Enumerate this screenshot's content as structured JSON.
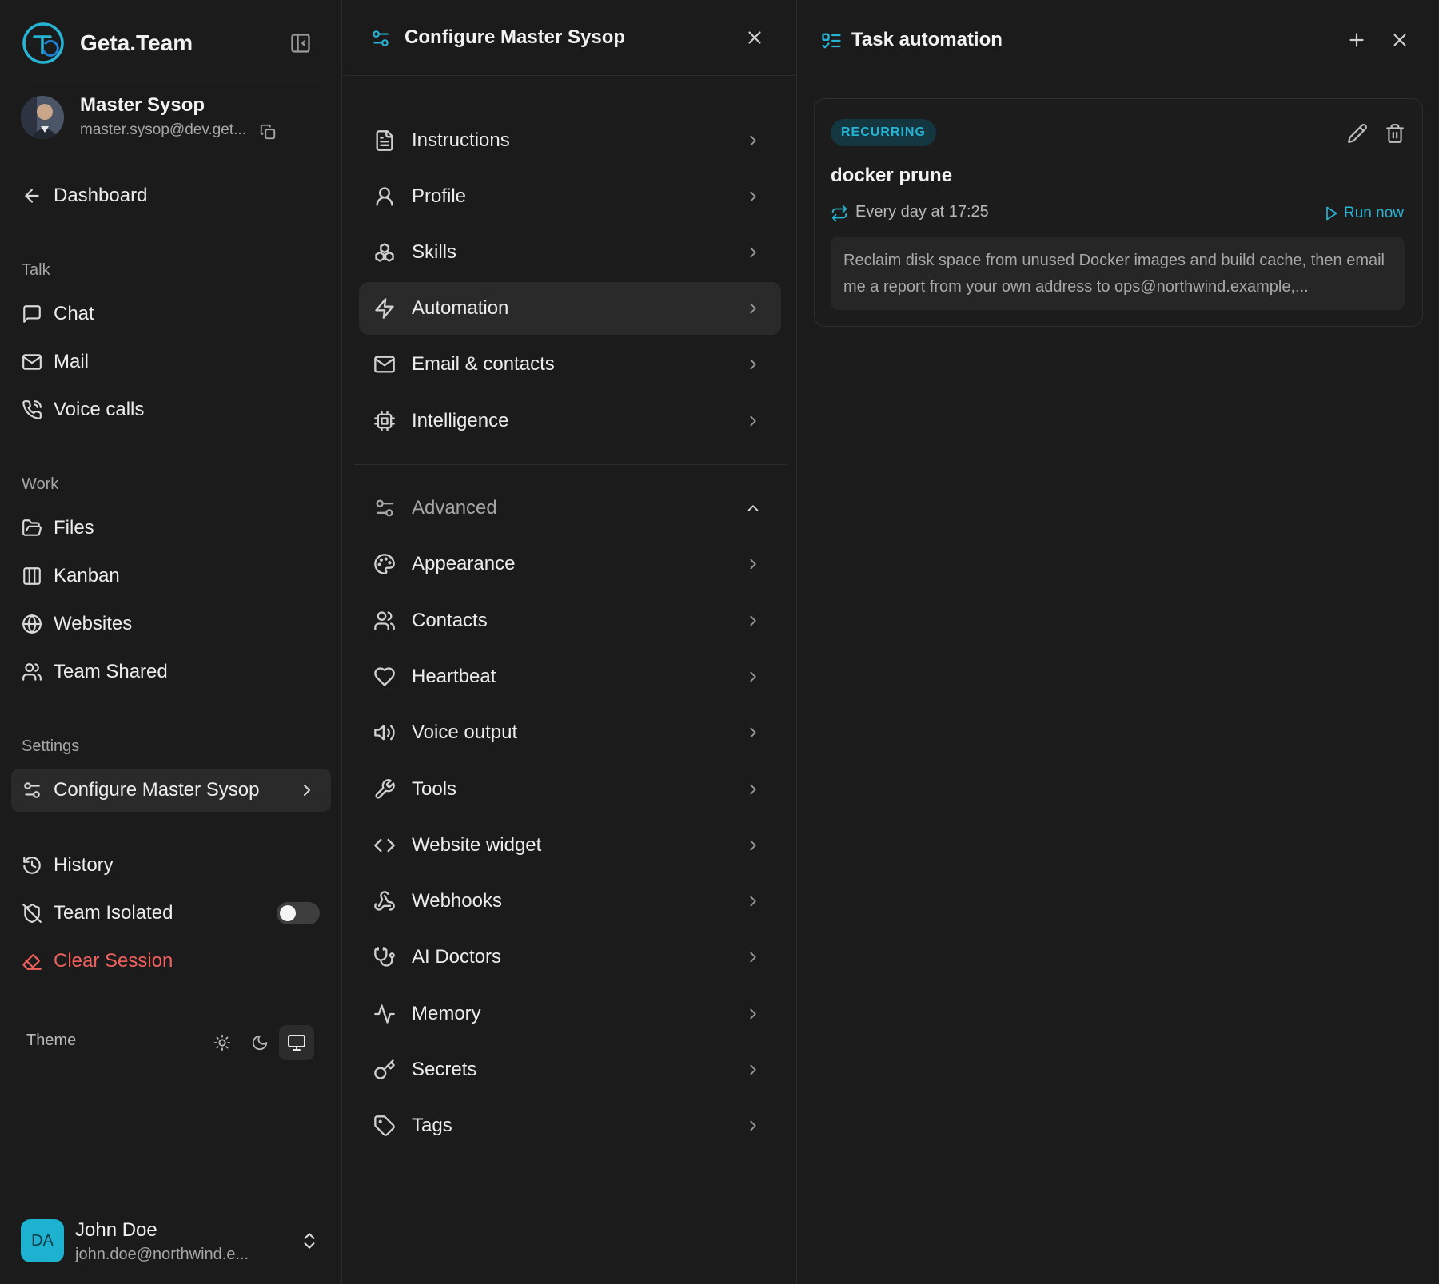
{
  "sidebar": {
    "brand_name": "Geta.Team",
    "agent": {
      "name": "Master Sysop",
      "email": "master.sysop@dev.get..."
    },
    "dashboard_label": "Dashboard",
    "sections": {
      "talk": "Talk",
      "work": "Work",
      "settings": "Settings"
    },
    "talk_items": [
      "Chat",
      "Mail",
      "Voice calls"
    ],
    "work_items": [
      "Files",
      "Kanban",
      "Websites",
      "Team Shared"
    ],
    "settings_item": "Configure Master Sysop",
    "history_label": "History",
    "team_isolated_label": "Team Isolated",
    "team_isolated_on": false,
    "clear_session_label": "Clear Session",
    "theme_label": "Theme",
    "theme_selected": "system",
    "user": {
      "initials": "DA",
      "name": "John Doe",
      "email": "john.doe@northwind.e..."
    },
    "colors": {
      "accent": "#27b3d3",
      "danger": "#f0605d"
    }
  },
  "config": {
    "title": "Configure Master Sysop",
    "items": [
      "Instructions",
      "Profile",
      "Skills",
      "Automation",
      "Email & contacts",
      "Intelligence"
    ],
    "active_item": "Automation",
    "advanced_label": "Advanced",
    "advanced_items": [
      "Appearance",
      "Contacts",
      "Heartbeat",
      "Voice output",
      "Tools",
      "Website widget",
      "Webhooks",
      "AI Doctors",
      "Memory",
      "Secrets",
      "Tags"
    ]
  },
  "tasks": {
    "title": "Task automation",
    "card": {
      "badge": "RECURRING",
      "title": "docker prune",
      "schedule": "Every day at 17:25",
      "run_now_label": "Run now",
      "description": "Reclaim disk space from unused Docker images and build cache, then email me a report from your own address to ops@northwind.example,..."
    }
  }
}
